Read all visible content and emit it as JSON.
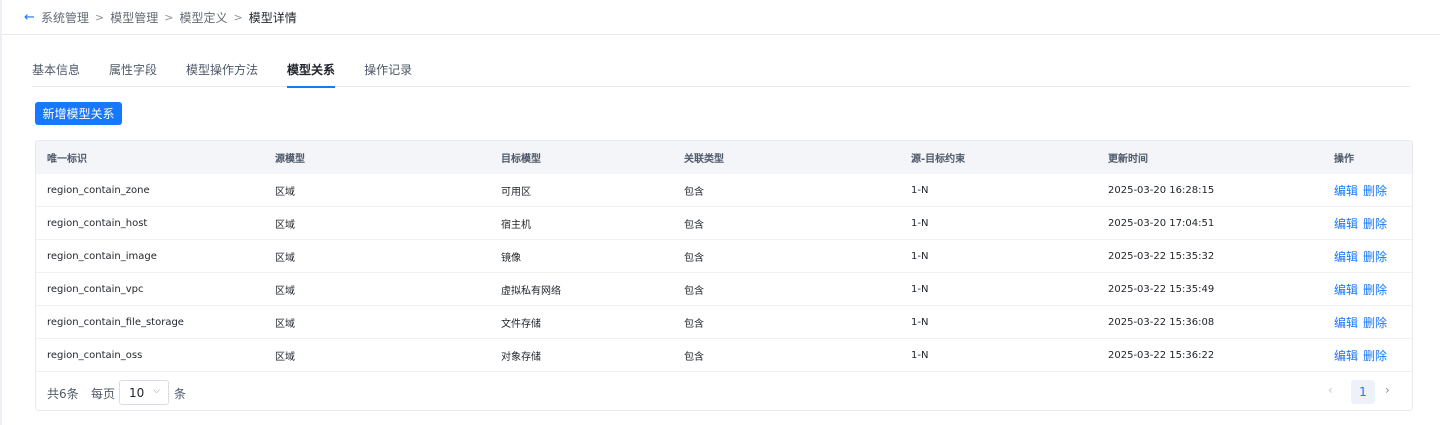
{
  "breadcrumb": {
    "items": [
      "系统管理",
      "模型管理",
      "模型定义"
    ],
    "current": "模型详情"
  },
  "tabs": [
    {
      "label": "基本信息"
    },
    {
      "label": "属性字段"
    },
    {
      "label": "模型操作方法"
    },
    {
      "label": "模型关系",
      "active": true
    },
    {
      "label": "操作记录"
    }
  ],
  "toolbar": {
    "add_label": "新增模型关系"
  },
  "table": {
    "columns": [
      "唯一标识",
      "源模型",
      "目标模型",
      "关联类型",
      "源-目标约束",
      "更新时间",
      "操作"
    ],
    "rows": [
      {
        "id": "region_contain_zone",
        "source": "区域",
        "target": "可用区",
        "type": "包含",
        "constraint": "1-N",
        "updated": "2025-03-20 16:28:15"
      },
      {
        "id": "region_contain_host",
        "source": "区域",
        "target": "宿主机",
        "type": "包含",
        "constraint": "1-N",
        "updated": "2025-03-20 17:04:51"
      },
      {
        "id": "region_contain_image",
        "source": "区域",
        "target": "镜像",
        "type": "包含",
        "constraint": "1-N",
        "updated": "2025-03-22 15:35:32"
      },
      {
        "id": "region_contain_vpc",
        "source": "区域",
        "target": "虚拟私有网络",
        "type": "包含",
        "constraint": "1-N",
        "updated": "2025-03-22 15:35:49"
      },
      {
        "id": "region_contain_file_storage",
        "source": "区域",
        "target": "文件存储",
        "type": "包含",
        "constraint": "1-N",
        "updated": "2025-03-22 15:36:08"
      },
      {
        "id": "region_contain_oss",
        "source": "区域",
        "target": "对象存储",
        "type": "包含",
        "constraint": "1-N",
        "updated": "2025-03-22 15:36:22"
      }
    ],
    "actions": {
      "edit": "编辑",
      "delete": "删除"
    }
  },
  "pagination": {
    "total_text": "共6条",
    "per_page_label": "每页",
    "page_size": "10",
    "unit": "条",
    "current_page": "1"
  },
  "colors": {
    "accent": "#1677ff"
  }
}
